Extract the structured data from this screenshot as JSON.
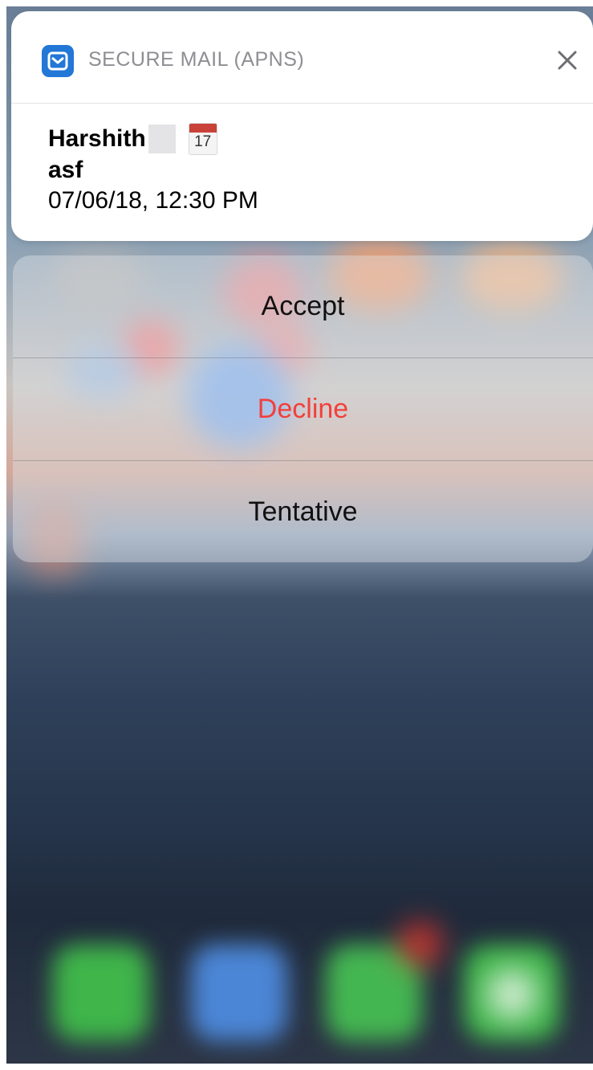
{
  "notification": {
    "app_name": "SECURE MAIL (APNS)",
    "app_icon": "mail-icon",
    "close_icon": "close-icon",
    "sender": "Harshith",
    "calendar_day": "17",
    "subject": "asf",
    "datetime": "07/06/18, 12:30 PM"
  },
  "actions": {
    "accept_label": "Accept",
    "decline_label": "Decline",
    "tentative_label": "Tentative"
  },
  "colors": {
    "app_icon_bg": "#2377d6",
    "decline_text": "#f2403c",
    "app_name_text": "#8e8e93"
  }
}
